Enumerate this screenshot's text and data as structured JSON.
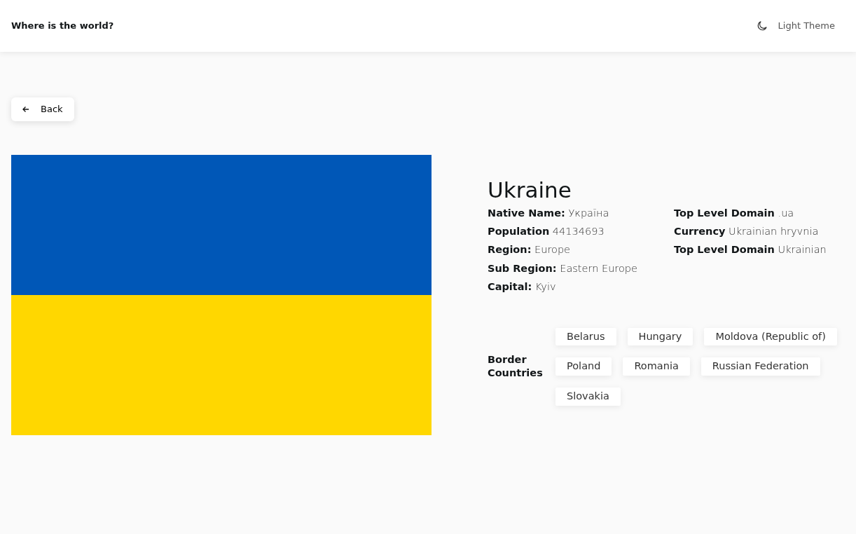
{
  "header": {
    "title": "Where is the world?",
    "theme_toggle": "Light Theme"
  },
  "back_button": "Back",
  "country": {
    "name": "Ukraine",
    "info_left": [
      {
        "label": "Native Name:",
        "value": "Україна"
      },
      {
        "label": "Population",
        "value": "44134693"
      },
      {
        "label": "Region:",
        "value": "Europe"
      },
      {
        "label": "Sub Region:",
        "value": "Eastern Europe"
      },
      {
        "label": "Capital:",
        "value": "Kyiv"
      }
    ],
    "info_right": [
      {
        "label": "Top Level Domain",
        "value": ".ua"
      },
      {
        "label": "Currency",
        "value": "Ukrainian hryvnia"
      },
      {
        "label": "Top Level Domain",
        "value": "Ukrainian"
      }
    ],
    "border_label": "Border Countries",
    "borders": [
      "Belarus",
      "Hungary",
      "Moldova (Republic of)",
      "Poland",
      "Romania",
      "Russian Federation",
      "Slovakia"
    ]
  }
}
